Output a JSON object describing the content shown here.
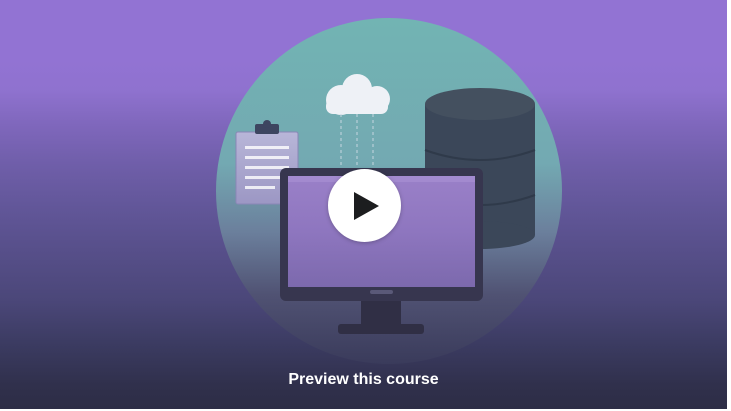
{
  "preview": {
    "caption": "Preview this course",
    "play_icon": "play-icon",
    "illustration": [
      "cloud-icon",
      "clipboard-icon",
      "database-icon",
      "monitor-icon"
    ]
  },
  "colors": {
    "top_background": "#9273d3",
    "bottom_background": "#2d2d46",
    "circle": "#72b4b3",
    "database": "#3b4759",
    "monitor_frame": "#37364f",
    "play_button": "#ffffff",
    "caption_text": "#ffffff"
  }
}
